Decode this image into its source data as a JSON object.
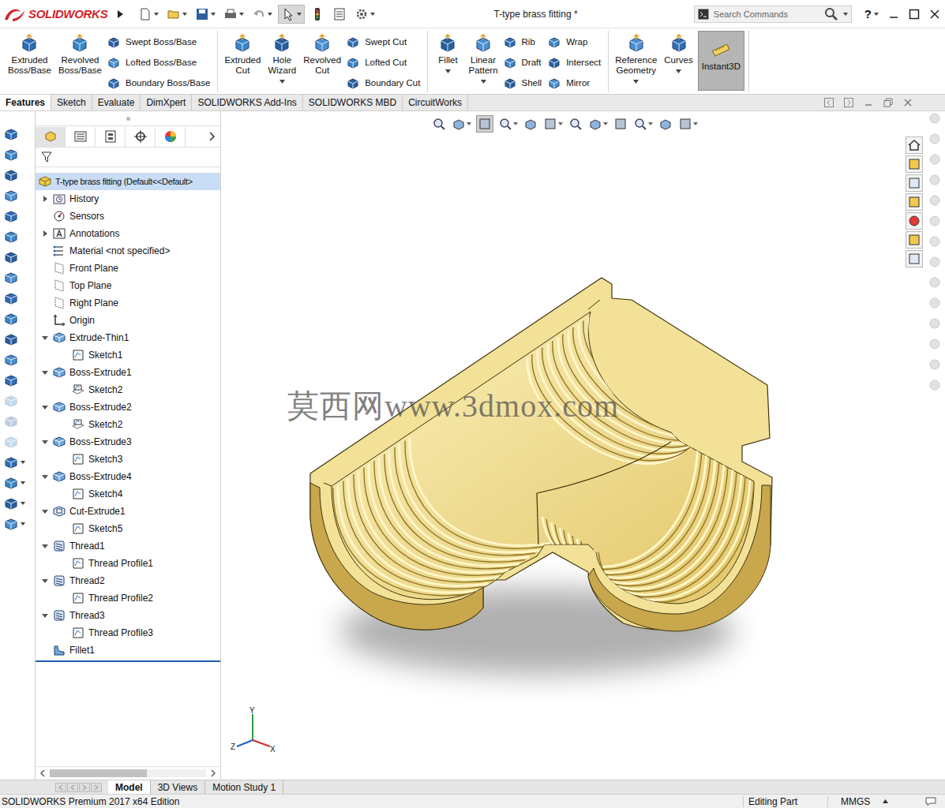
{
  "window": {
    "title": "T-type brass fitting *"
  },
  "app": {
    "name": "SOLIDWORKS"
  },
  "search": {
    "placeholder": "Search Commands"
  },
  "help": "?",
  "ribbon": {
    "groups": [
      {
        "items": [
          {
            "kind": "big",
            "lines": [
              "Extruded",
              "Boss/Base"
            ],
            "dropdown": false,
            "selected": false
          },
          {
            "kind": "big",
            "lines": [
              "Revolved",
              "Boss/Base"
            ],
            "dropdown": false,
            "selected": false
          },
          {
            "kind": "stack",
            "entries": [
              "Swept Boss/Base",
              "Lofted Boss/Base",
              "Boundary Boss/Base"
            ]
          }
        ]
      },
      {
        "items": [
          {
            "kind": "big",
            "lines": [
              "Extruded",
              "Cut"
            ],
            "dropdown": false,
            "selected": false
          },
          {
            "kind": "big",
            "lines": [
              "Hole",
              "Wizard"
            ],
            "dropdown": true,
            "selected": false
          },
          {
            "kind": "big",
            "lines": [
              "Revolved",
              "Cut"
            ],
            "dropdown": false,
            "selected": false
          },
          {
            "kind": "stack",
            "entries": [
              "Swept Cut",
              "Lofted Cut",
              "Boundary Cut"
            ]
          }
        ]
      },
      {
        "items": [
          {
            "kind": "big",
            "lines": [
              "Fillet"
            ],
            "dropdown": true,
            "selected": false
          },
          {
            "kind": "big",
            "lines": [
              "Linear",
              "Pattern"
            ],
            "dropdown": true,
            "selected": false
          },
          {
            "kind": "stack",
            "entries": [
              "Rib",
              "Draft",
              "Shell"
            ]
          },
          {
            "kind": "stack",
            "entries": [
              "Wrap",
              "Intersect",
              "Mirror"
            ]
          }
        ]
      },
      {
        "items": [
          {
            "kind": "big",
            "lines": [
              "Reference",
              "Geometry"
            ],
            "dropdown": true,
            "selected": false
          },
          {
            "kind": "big",
            "lines": [
              "Curves"
            ],
            "dropdown": true,
            "selected": false
          },
          {
            "kind": "big",
            "lines": [
              "Instant3D"
            ],
            "dropdown": false,
            "selected": true
          }
        ]
      }
    ]
  },
  "command_tabs": [
    {
      "label": "Features",
      "selected": true
    },
    {
      "label": "Sketch",
      "selected": false
    },
    {
      "label": "Evaluate",
      "selected": false
    },
    {
      "label": "DimXpert",
      "selected": false
    },
    {
      "label": "SOLIDWORKS Add-Ins",
      "selected": false
    },
    {
      "label": "SOLIDWORKS MBD",
      "selected": false
    },
    {
      "label": "CircuitWorks",
      "selected": false
    }
  ],
  "feature_tree": {
    "items": [
      {
        "label": "T-type brass fitting  (Default<<Default>",
        "kind": "part",
        "level": 0,
        "expandable": false,
        "expanded": false,
        "selected": true
      },
      {
        "label": "History",
        "kind": "history",
        "level": 1,
        "expandable": true,
        "expanded": false,
        "selected": false
      },
      {
        "label": "Sensors",
        "kind": "sensor",
        "level": 1,
        "expandable": false,
        "expanded": false,
        "selected": false
      },
      {
        "label": "Annotations",
        "kind": "annotation",
        "level": 1,
        "expandable": true,
        "expanded": false,
        "selected": false
      },
      {
        "label": "Material <not specified>",
        "kind": "material",
        "level": 1,
        "expandable": false,
        "expanded": false,
        "selected": false
      },
      {
        "label": "Front Plane",
        "kind": "plane",
        "level": 1,
        "expandable": false,
        "expanded": false,
        "selected": false
      },
      {
        "label": "Top Plane",
        "kind": "plane",
        "level": 1,
        "expandable": false,
        "expanded": false,
        "selected": false
      },
      {
        "label": "Right Plane",
        "kind": "plane",
        "level": 1,
        "expandable": false,
        "expanded": false,
        "selected": false
      },
      {
        "label": "Origin",
        "kind": "origin",
        "level": 1,
        "expandable": false,
        "expanded": false,
        "selected": false
      },
      {
        "label": "Extrude-Thin1",
        "kind": "feature",
        "level": 1,
        "expandable": true,
        "expanded": true,
        "selected": false
      },
      {
        "label": "Sketch1",
        "kind": "sketch",
        "level": 2,
        "expandable": false,
        "expanded": false,
        "selected": false
      },
      {
        "label": "Boss-Extrude1",
        "kind": "feature",
        "level": 1,
        "expandable": true,
        "expanded": true,
        "selected": false
      },
      {
        "label": "Sketch2",
        "kind": "shared-sketch",
        "level": 2,
        "expandable": false,
        "expanded": false,
        "selected": false
      },
      {
        "label": "Boss-Extrude2",
        "kind": "feature",
        "level": 1,
        "expandable": true,
        "expanded": true,
        "selected": false
      },
      {
        "label": "Sketch2",
        "kind": "shared-sketch",
        "level": 2,
        "expandable": false,
        "expanded": false,
        "selected": false
      },
      {
        "label": "Boss-Extrude3",
        "kind": "feature",
        "level": 1,
        "expandable": true,
        "expanded": true,
        "selected": false
      },
      {
        "label": "Sketch3",
        "kind": "sketch",
        "level": 2,
        "expandable": false,
        "expanded": false,
        "selected": false
      },
      {
        "label": "Boss-Extrude4",
        "kind": "feature",
        "level": 1,
        "expandable": true,
        "expanded": true,
        "selected": false
      },
      {
        "label": "Sketch4",
        "kind": "sketch",
        "level": 2,
        "expandable": false,
        "expanded": false,
        "selected": false
      },
      {
        "label": "Cut-Extrude1",
        "kind": "cut",
        "level": 1,
        "expandable": true,
        "expanded": true,
        "selected": false
      },
      {
        "label": "Sketch5",
        "kind": "sketch",
        "level": 2,
        "expandable": false,
        "expanded": false,
        "selected": false
      },
      {
        "label": "Thread1",
        "kind": "thread",
        "level": 1,
        "expandable": true,
        "expanded": true,
        "selected": false
      },
      {
        "label": "Thread Profile1",
        "kind": "sketch",
        "level": 2,
        "expandable": false,
        "expanded": false,
        "selected": false
      },
      {
        "label": "Thread2",
        "kind": "thread",
        "level": 1,
        "expandable": true,
        "expanded": true,
        "selected": false
      },
      {
        "label": "Thread Profile2",
        "kind": "sketch",
        "level": 2,
        "expandable": false,
        "expanded": false,
        "selected": false
      },
      {
        "label": "Thread3",
        "kind": "thread",
        "level": 1,
        "expandable": true,
        "expanded": true,
        "selected": false
      },
      {
        "label": "Thread Profile3",
        "kind": "sketch",
        "level": 2,
        "expandable": false,
        "expanded": false,
        "selected": false
      },
      {
        "label": "Fillet1",
        "kind": "fillet",
        "level": 1,
        "expandable": false,
        "expanded": false,
        "selected": false
      }
    ]
  },
  "viewport": {
    "watermark": "莫西网www.3dmox.com",
    "triad": {
      "y": "Y",
      "z": "Z",
      "x": "X"
    }
  },
  "bottom_tabs": [
    {
      "label": "Model",
      "selected": true
    },
    {
      "label": "3D Views",
      "selected": false
    },
    {
      "label": "Motion Study 1",
      "selected": false
    }
  ],
  "status_bar": {
    "edition": "SOLIDWORKS Premium 2017 x64 Edition",
    "mode": "Editing Part",
    "units": "MMGS"
  }
}
